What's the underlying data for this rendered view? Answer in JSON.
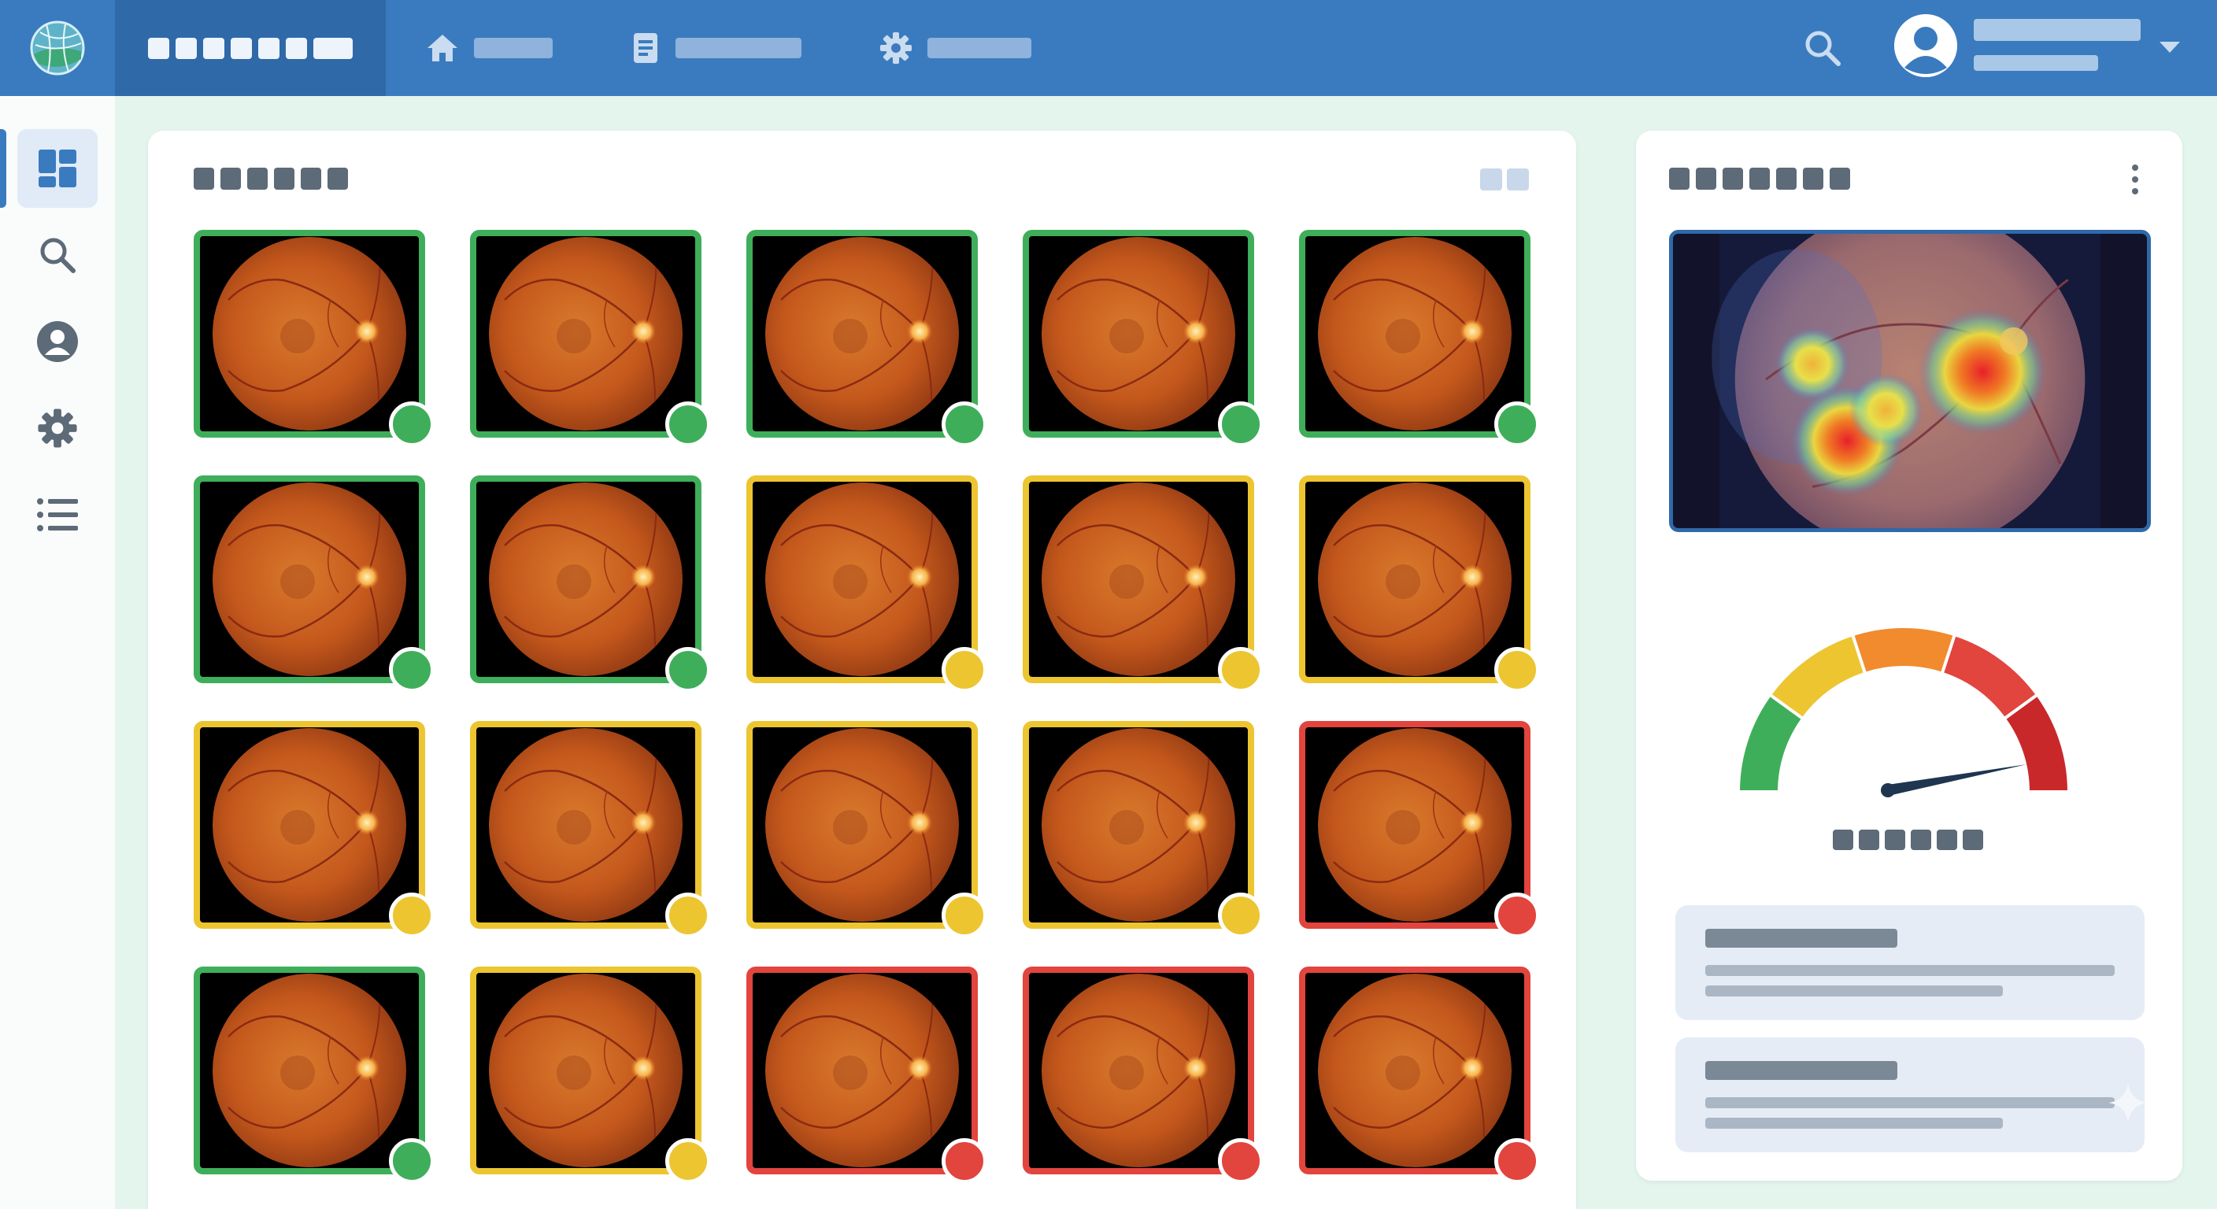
{
  "colors": {
    "header": "#3a7bbf",
    "header_dark": "#2f69a8",
    "background": "#e3f5ec",
    "status_normal": "#3fae5a",
    "status_moderate": "#ecc531",
    "status_severe": "#e2443e"
  },
  "header": {
    "logo_icon": "globe-logo-icon",
    "nav_items": [
      {
        "icon": "home-icon"
      },
      {
        "icon": "document-icon"
      },
      {
        "icon": "gear-icon"
      }
    ],
    "search_icon": "search-icon",
    "avatar_icon": "user-avatar-icon",
    "menu_icon": "chevron-down-icon"
  },
  "sidebar": {
    "items": [
      {
        "icon": "dashboard-icon",
        "active": true
      },
      {
        "icon": "search-icon",
        "active": false
      },
      {
        "icon": "user-icon",
        "active": false
      },
      {
        "icon": "gear-icon",
        "active": false
      },
      {
        "icon": "list-icon",
        "active": false
      }
    ]
  },
  "gallery": {
    "view_toggle_icon": "grid-view-icon",
    "tiles": [
      {
        "status": "normal"
      },
      {
        "status": "normal"
      },
      {
        "status": "normal"
      },
      {
        "status": "normal"
      },
      {
        "status": "normal"
      },
      {
        "status": "normal"
      },
      {
        "status": "normal"
      },
      {
        "status": "moderate"
      },
      {
        "status": "moderate"
      },
      {
        "status": "moderate"
      },
      {
        "status": "moderate"
      },
      {
        "status": "moderate"
      },
      {
        "status": "moderate"
      },
      {
        "status": "moderate"
      },
      {
        "status": "severe"
      },
      {
        "status": "normal"
      },
      {
        "status": "moderate"
      },
      {
        "status": "severe"
      },
      {
        "status": "severe"
      },
      {
        "status": "severe"
      }
    ]
  },
  "detail": {
    "menu_icon": "kebab-menu-icon",
    "heatmap_icon": "retina-heatmap-icon",
    "gauge": {
      "segments": [
        "#3fae5a",
        "#ecc531",
        "#f28a2e",
        "#e2443e",
        "#c9282b"
      ],
      "needle_level": 0.93
    },
    "cards": [
      {
        "icon": "report-card"
      },
      {
        "icon": "report-card"
      }
    ],
    "sparkle_icon": "sparkle-icon"
  }
}
